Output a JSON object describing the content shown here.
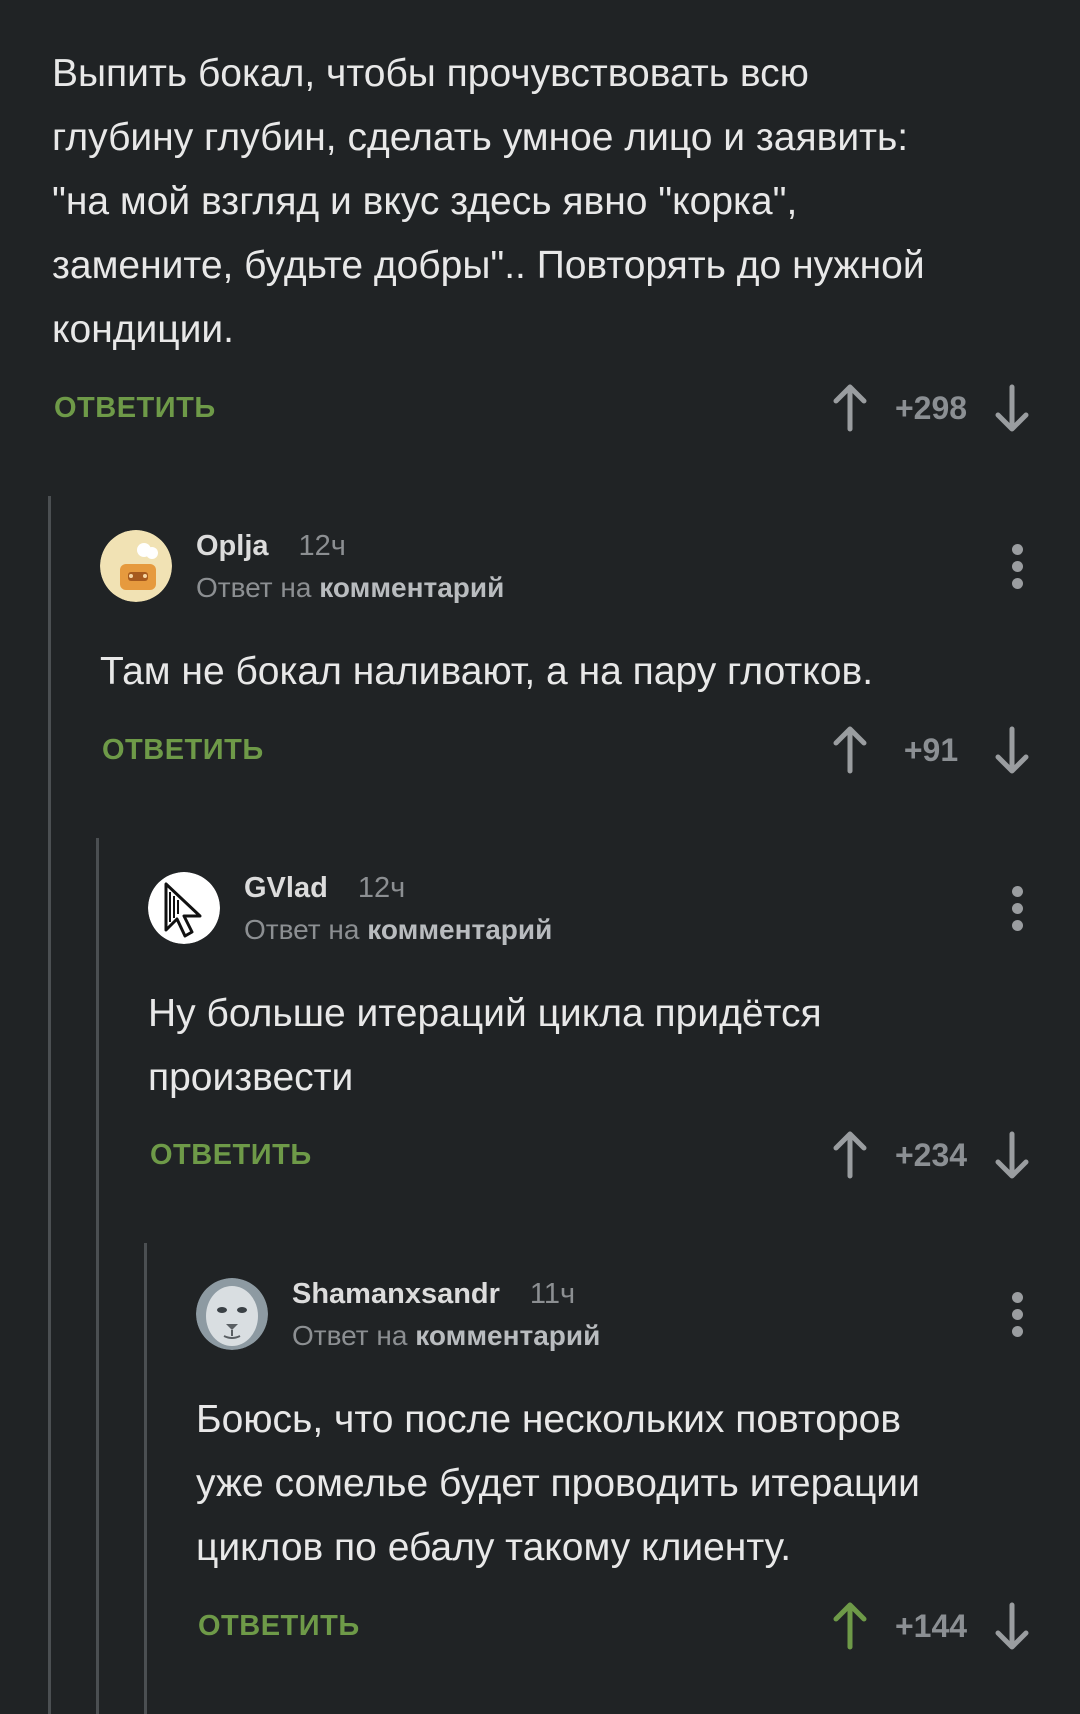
{
  "top_comment": {
    "text_lines": [
      "Выпить бокал, чтобы прочувствовать всю",
      "глубину глубин, сделать умное лицо и заявить:",
      "\"на мой взгляд и вкус здесь явно \"корка\",",
      "замените, будьте добры\".. Повторять до нужной",
      "кондиции."
    ],
    "reply_label": "ОТВЕТИТЬ",
    "score": "+298"
  },
  "comments": [
    {
      "username": "Oplja",
      "time": "12ч",
      "reply_prefix": "Ответ на",
      "reply_link": "комментарий",
      "text_lines": [
        "Там не бокал наливают, а на пару глотков."
      ],
      "reply_label": "ОТВЕТИТЬ",
      "score": "+91"
    },
    {
      "username": "GVlad",
      "time": "12ч",
      "reply_prefix": "Ответ на",
      "reply_link": "комментарий",
      "text_lines": [
        "Ну больше итераций цикла придётся",
        "произвести"
      ],
      "reply_label": "ОТВЕТИТЬ",
      "score": "+234"
    },
    {
      "username": "Shamanxsandr",
      "time": "11ч",
      "reply_prefix": "Ответ на",
      "reply_link": "комментарий",
      "text_lines": [
        "Боюсь, что после нескольких повторов",
        "уже сомелье будет проводить итерации",
        "циклов по ебалу такому клиенту."
      ],
      "reply_label": "ОТВЕТИТЬ",
      "score": "+144",
      "upvoted": true
    }
  ],
  "icons": {
    "upvote": "arrow-up-icon",
    "downvote": "arrow-down-icon",
    "menu": "more-vertical-icon"
  },
  "colors": {
    "background": "#202325",
    "reply": "#6e9a48",
    "upvote_active": "#6e9a48",
    "arrow_inactive": "#9a9da0",
    "thread_line": "#4b4f52"
  }
}
